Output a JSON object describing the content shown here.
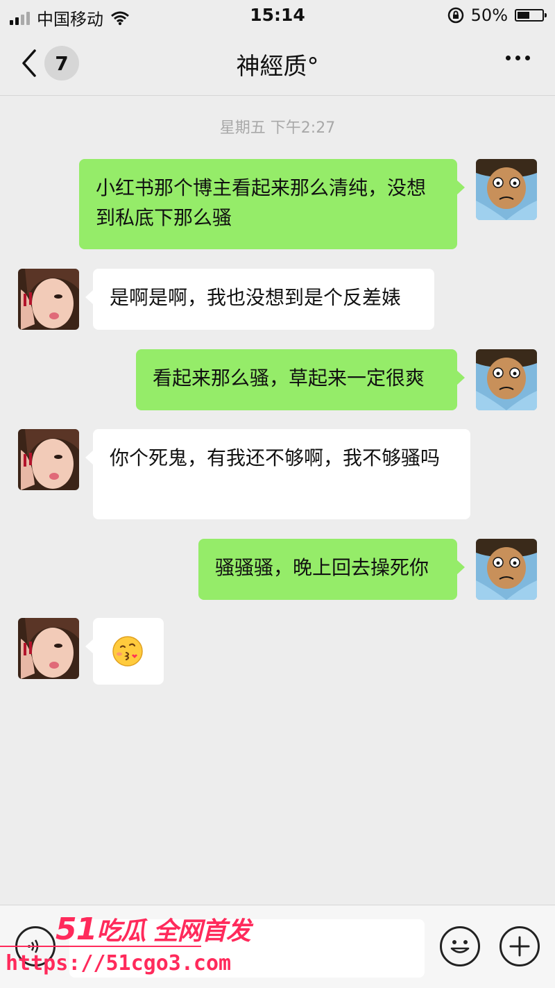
{
  "status_bar": {
    "carrier": "中国移动",
    "time": "15:14",
    "battery_percent_text": "50%",
    "battery_level": 0.5
  },
  "nav": {
    "unread_count": "7",
    "title": "神經质°"
  },
  "chat": {
    "timestamp": "星期五 下午2:27",
    "messages": [
      {
        "sender": "me",
        "text": "小红书那个博主看起来那么清纯，没想到私底下那么骚"
      },
      {
        "sender": "them",
        "text": "是啊是啊，我也没想到是个反差婊"
      },
      {
        "sender": "me",
        "text": "看起来那么骚，草起来一定很爽"
      },
      {
        "sender": "them",
        "text": "你个死鬼，有我还不够啊，我不够骚吗"
      },
      {
        "sender": "me",
        "text": "骚骚骚，晚上回去操死你"
      },
      {
        "sender": "them",
        "text": "",
        "emoji": "kissing-face-emoji"
      }
    ]
  },
  "watermark": {
    "brand_number": "51",
    "brand_text": "吃瓜 全网首发",
    "url": "https://51cgo3.com"
  },
  "colors": {
    "background": "#ededed",
    "my_bubble": "#95ec69",
    "their_bubble": "#ffffff",
    "watermark": "#ff2a5b"
  }
}
